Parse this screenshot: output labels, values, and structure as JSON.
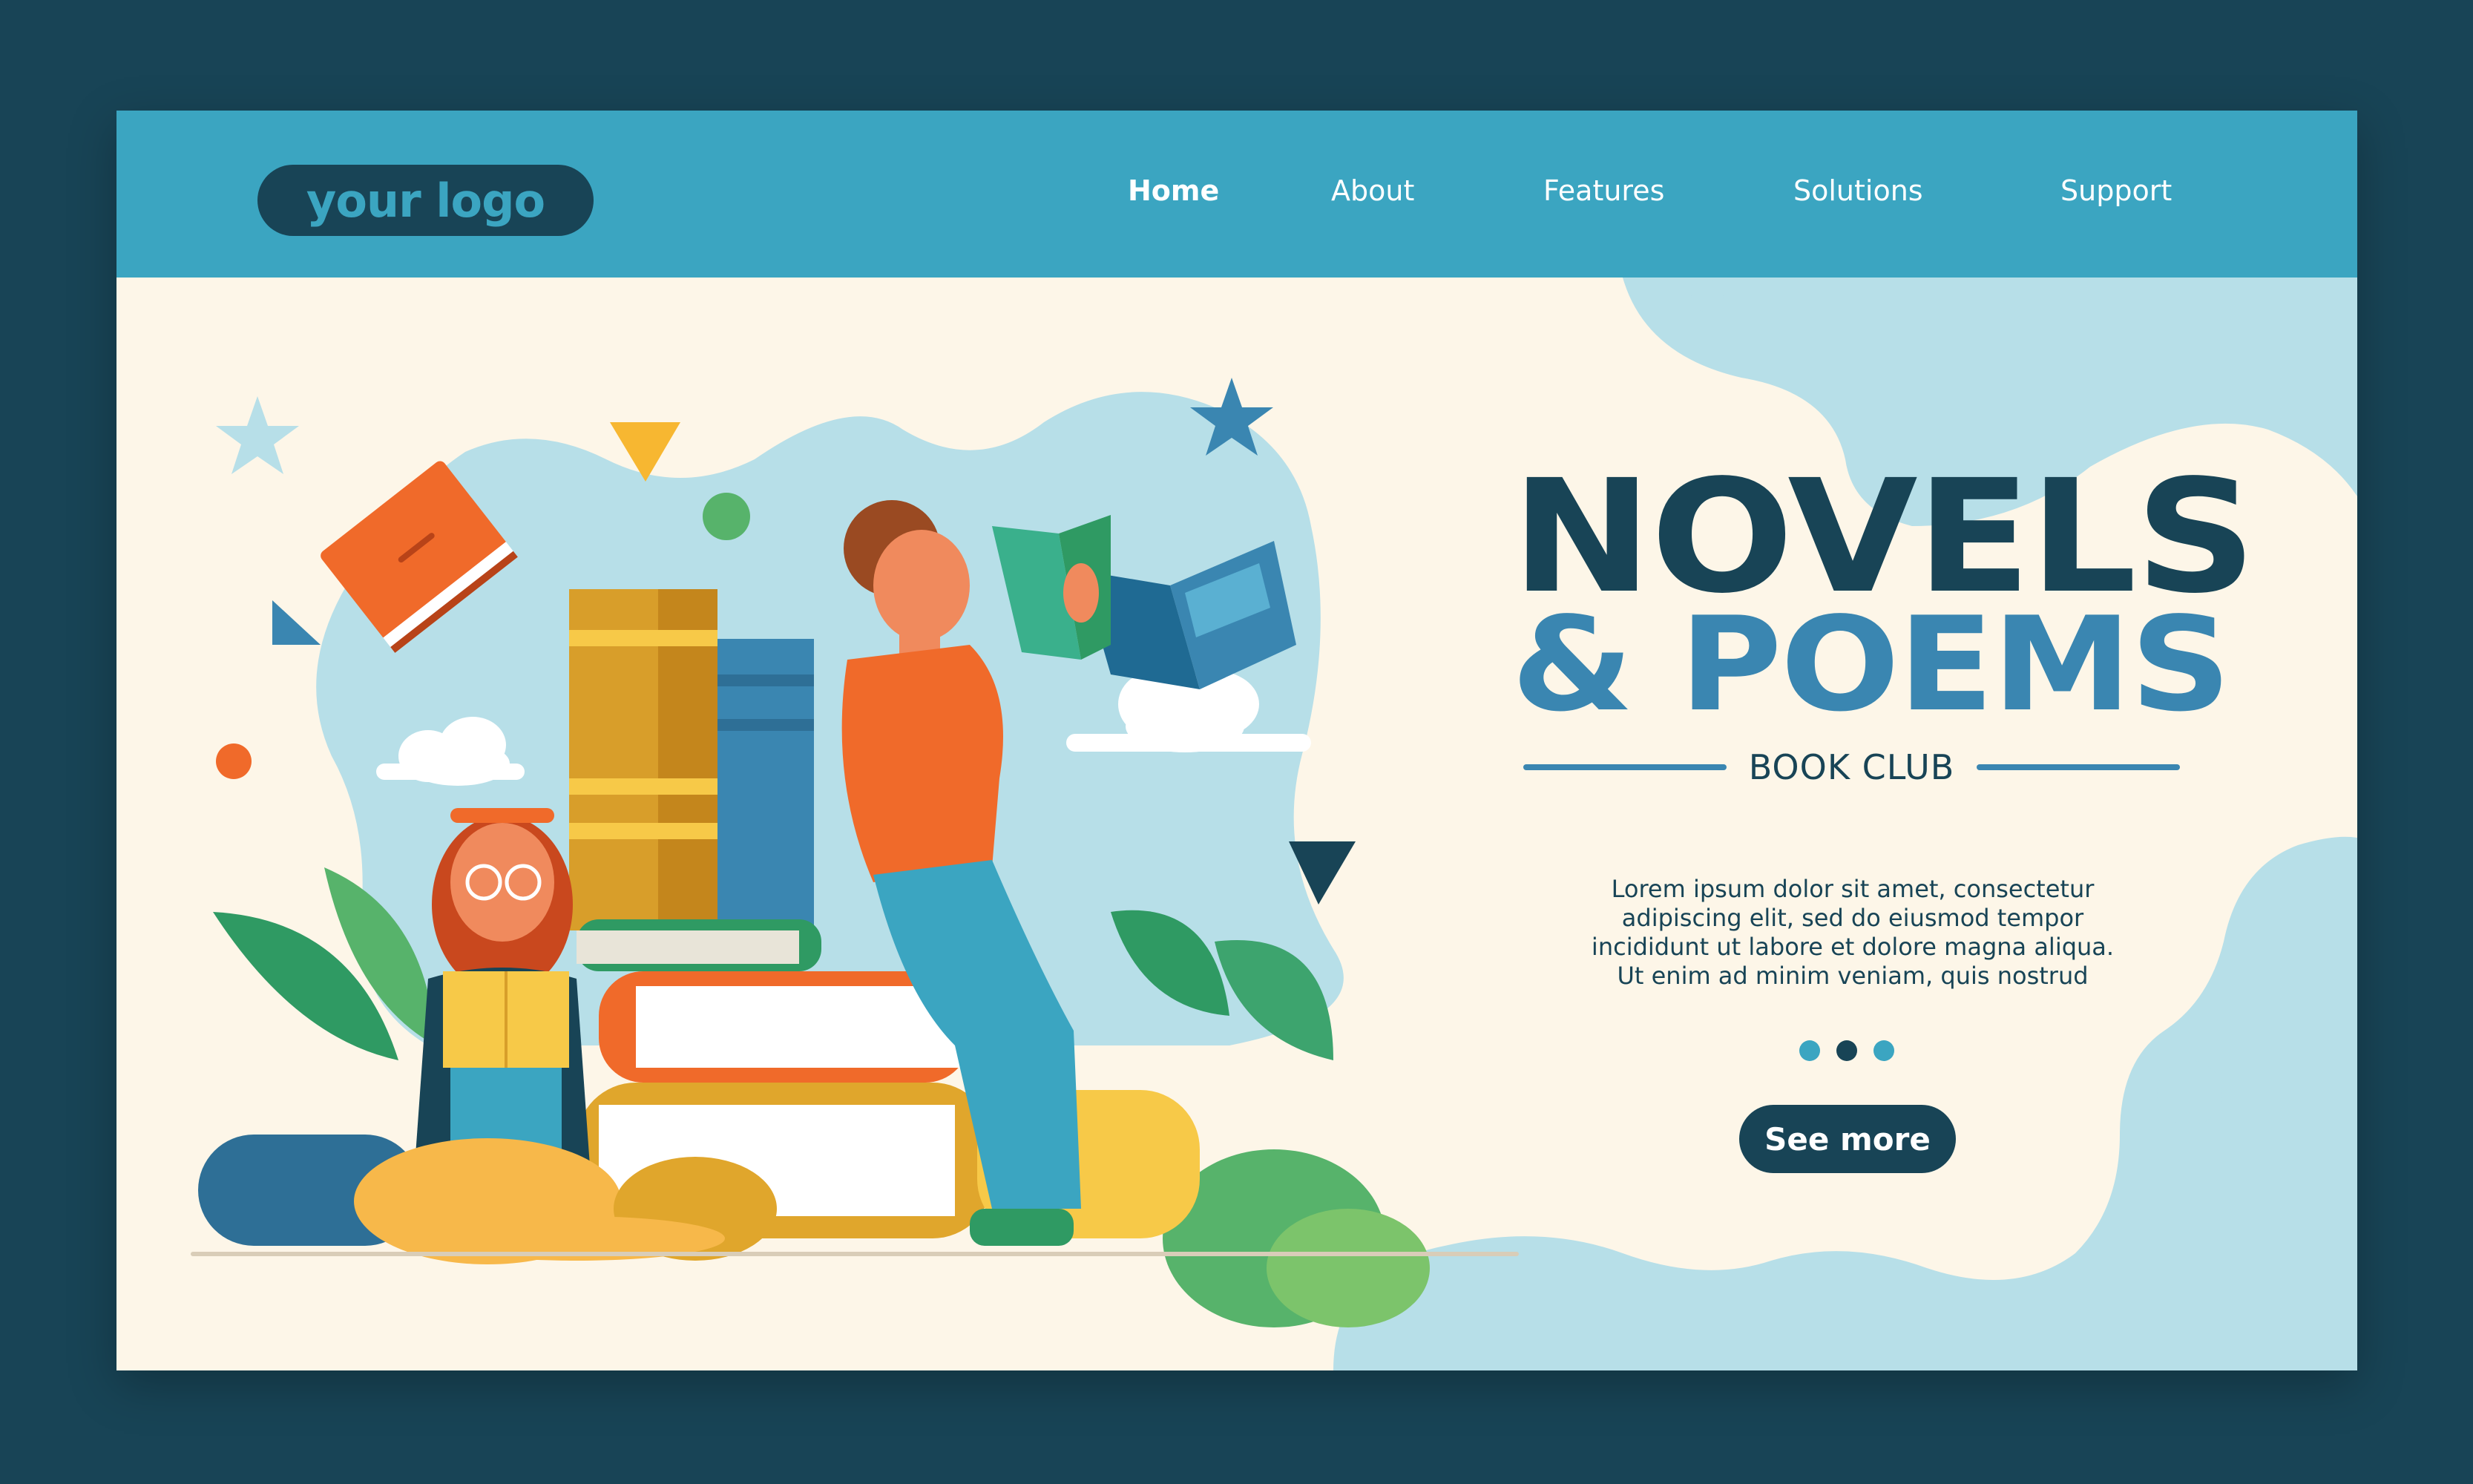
{
  "header": {
    "logo_text": "your logo",
    "nav": [
      {
        "label": "Home",
        "active": true
      },
      {
        "label": "About",
        "active": false
      },
      {
        "label": "Features",
        "active": false
      },
      {
        "label": "Solutions",
        "active": false
      },
      {
        "label": "Support",
        "active": false
      }
    ]
  },
  "hero": {
    "title_line1": "NOVELS",
    "title_line2": "& POEMS",
    "subtitle": "BOOK CLUB",
    "body_lines": [
      "Lorem ipsum dolor sit amet, consectetur",
      "adipiscing elit, sed do eiusmod tempor",
      "incididunt ut labore et dolore magna aliqua.",
      "Ut enim ad minim veniam, quis nostrud"
    ],
    "carousel": {
      "count": 3,
      "active_index": 1
    },
    "cta_label": "See more"
  },
  "colors": {
    "background_frame": "#184456",
    "navbar": "#3ba5c1",
    "page": "#fdf6e8",
    "title_dark": "#184456",
    "title_accent": "#3a86b1",
    "blob": "#b7dfe8"
  },
  "illustration": {
    "subject": "two people reading books among stacked books and plants",
    "icons": [
      "star-icon",
      "triangle-icon",
      "circle-icon",
      "cloud-icon",
      "book-icon",
      "leaf-icon"
    ]
  }
}
